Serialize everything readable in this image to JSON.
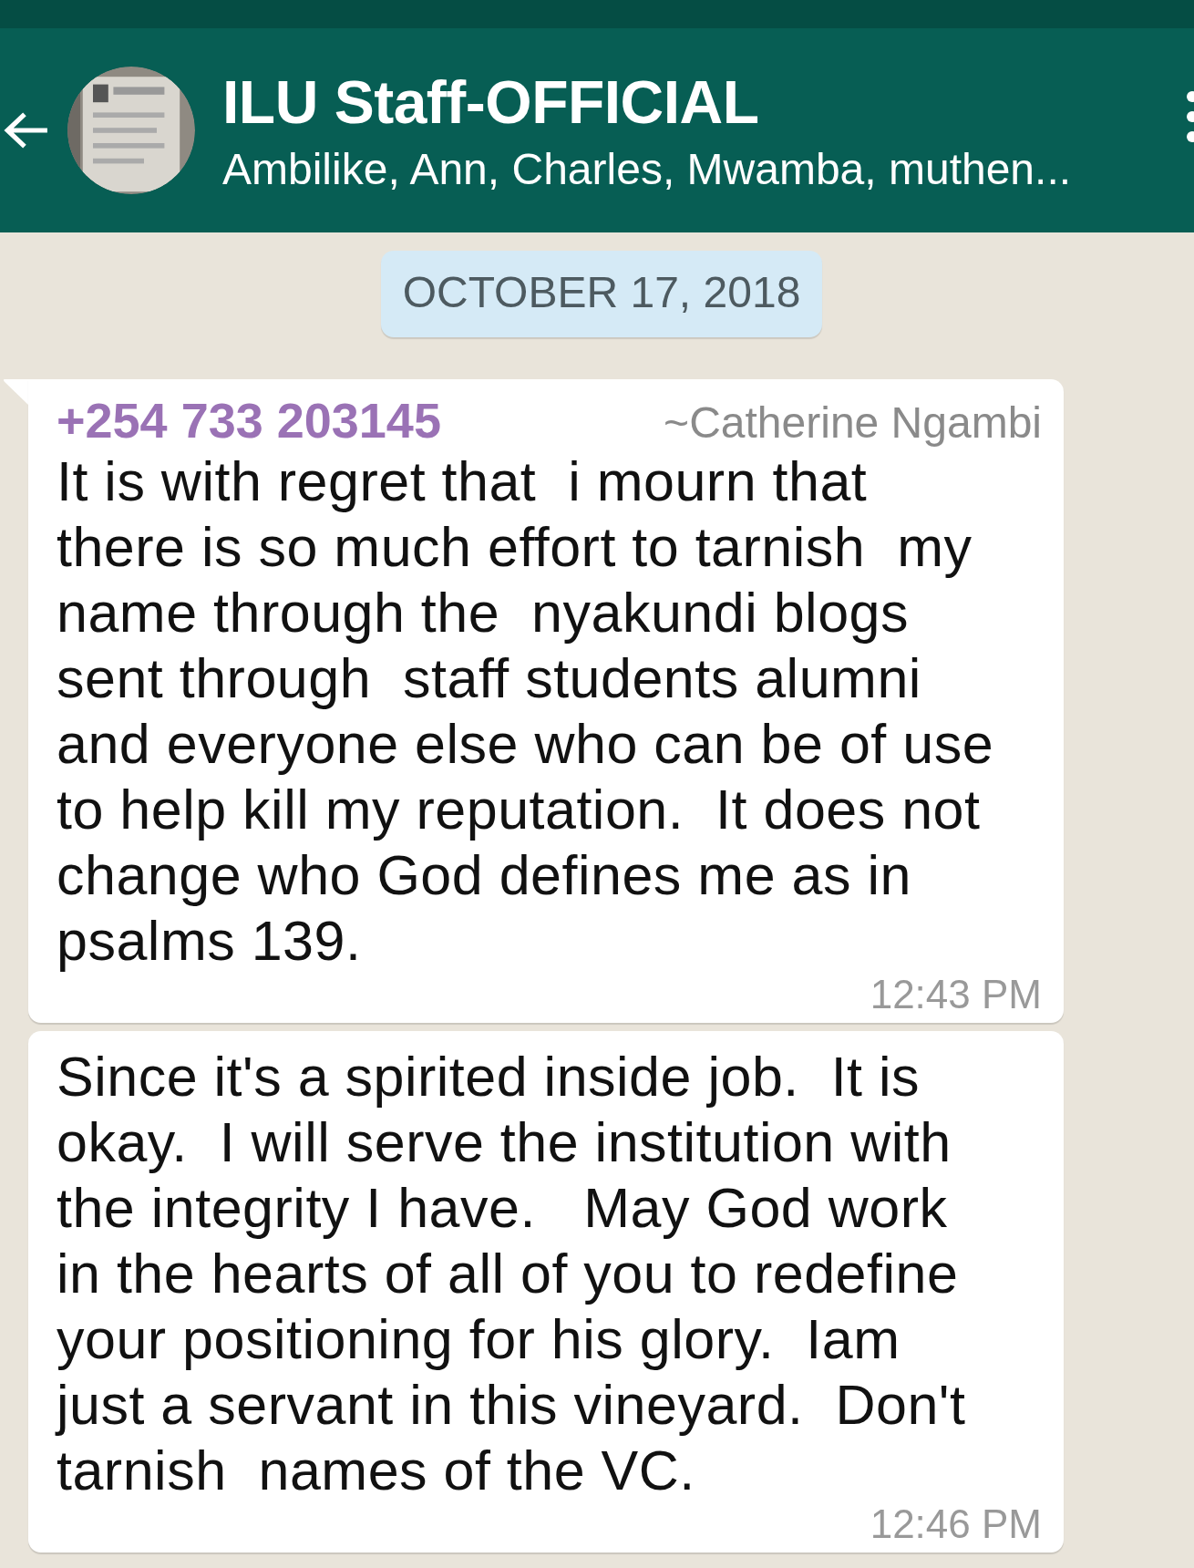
{
  "header": {
    "title": "ILU Staff-OFFICIAL",
    "subtitle": "Ambilike, Ann, Charles, Mwamba, muthen..."
  },
  "date_chip": "OCTOBER 17, 2018",
  "messages": [
    {
      "sender": "+254 733 203145",
      "color": "#9a72b5",
      "push_name": "~Catherine Ngambi",
      "text": "It is with regret that  i mourn that\nthere is so much effort to tarnish  my\nname through the  nyakundi blogs\nsent through  staff students alumni\nand everyone else who can be of use\nto help kill my reputation.  It does not\nchange who God defines me as in\npsalms 139.",
      "time": "12:43 PM",
      "first_in_group": true
    },
    {
      "text": "Since it's a spirited inside job.  It is\nokay.  I will serve the institution with\nthe integrity I have.   May God work\nin the hearts of all of you to redefine\nyour positioning for his glory.  Iam\njust a servant in this vineyard.  Don't\ntarnish  names of the VC.",
      "time": "12:46 PM",
      "first_in_group": false
    }
  ]
}
